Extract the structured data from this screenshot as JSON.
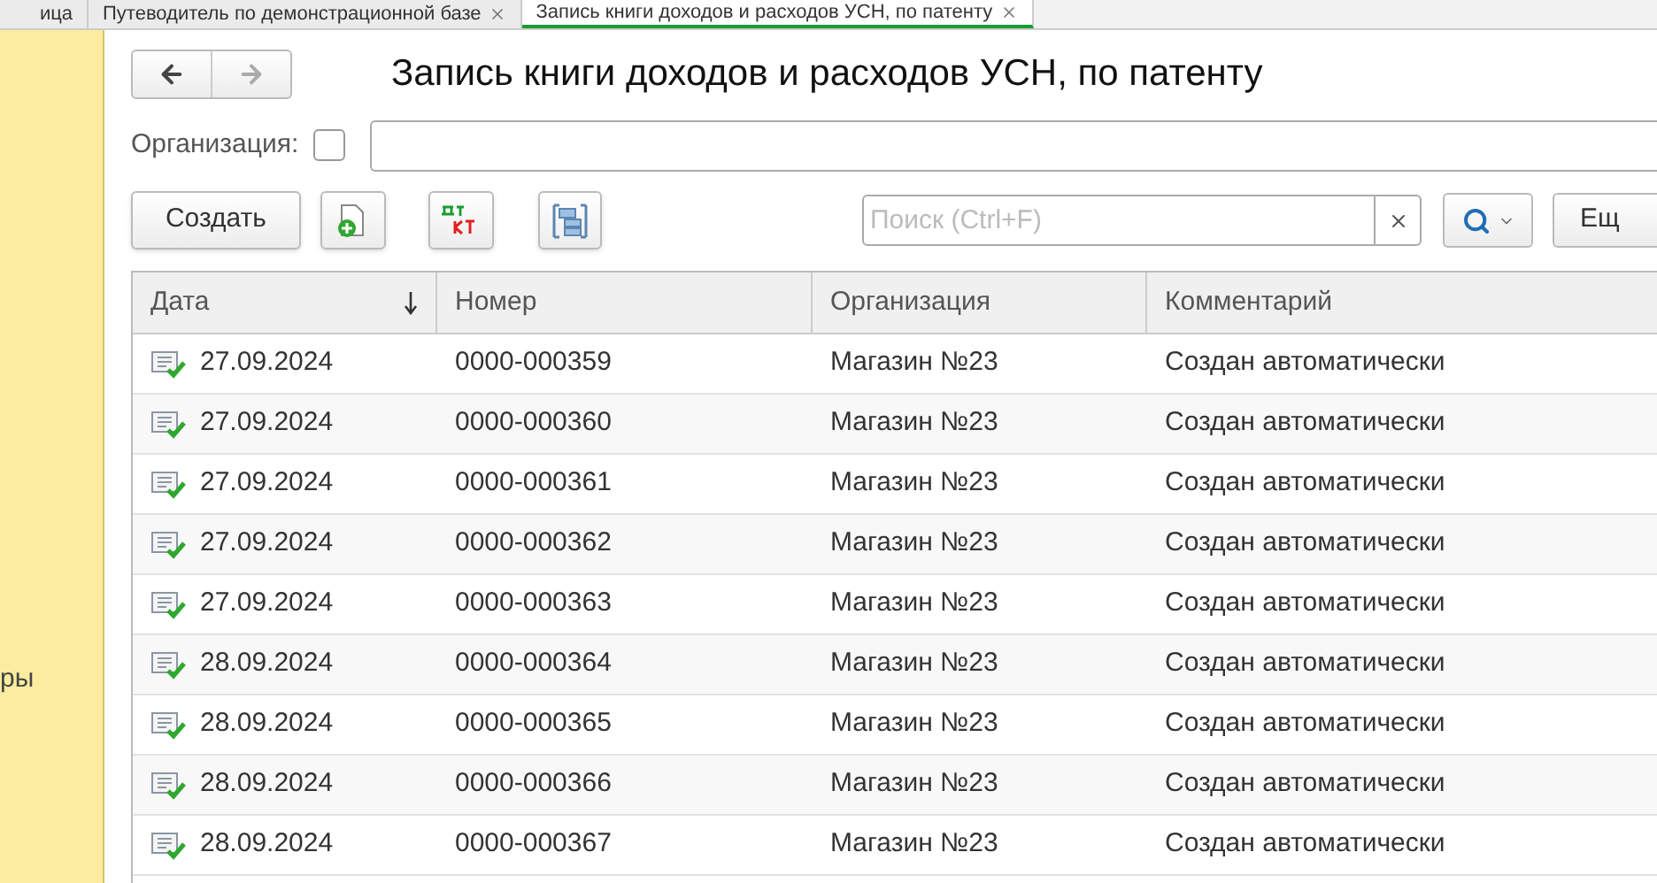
{
  "tabs": [
    {
      "label": "ица",
      "selected": false,
      "closable": false
    },
    {
      "label": "Путеводитель по демонстрационной базе",
      "selected": false,
      "closable": true
    },
    {
      "label": "Запись книги доходов и расходов УСН, по патенту",
      "selected": true,
      "closable": true
    }
  ],
  "sidebar": {
    "items": [
      "ры"
    ]
  },
  "form": {
    "title": "Запись книги доходов и расходов УСН, по патенту",
    "organization": {
      "label": "Организация:",
      "checked": false
    },
    "toolbar": {
      "create": "Создать",
      "search_placeholder": "Поиск (Ctrl+F)",
      "more": "Ещ"
    }
  },
  "table": {
    "columns": [
      {
        "label": "Дата",
        "sorted": true
      },
      {
        "label": "Номер",
        "sorted": false
      },
      {
        "label": "Организация",
        "sorted": false
      },
      {
        "label": "Комментарий",
        "sorted": false
      }
    ],
    "rows": [
      {
        "date": "27.09.2024",
        "number": "0000-000359",
        "organization": "Магазин №23",
        "comment": "Создан автоматически"
      },
      {
        "date": "27.09.2024",
        "number": "0000-000360",
        "organization": "Магазин №23",
        "comment": "Создан автоматически"
      },
      {
        "date": "27.09.2024",
        "number": "0000-000361",
        "organization": "Магазин №23",
        "comment": "Создан автоматически"
      },
      {
        "date": "27.09.2024",
        "number": "0000-000362",
        "organization": "Магазин №23",
        "comment": "Создан автоматически"
      },
      {
        "date": "27.09.2024",
        "number": "0000-000363",
        "organization": "Магазин №23",
        "comment": "Создан автоматически"
      },
      {
        "date": "28.09.2024",
        "number": "0000-000364",
        "organization": "Магазин №23",
        "comment": "Создан автоматически"
      },
      {
        "date": "28.09.2024",
        "number": "0000-000365",
        "organization": "Магазин №23",
        "comment": "Создан автоматически"
      },
      {
        "date": "28.09.2024",
        "number": "0000-000366",
        "organization": "Магазин №23",
        "comment": "Создан автоматически"
      },
      {
        "date": "28.09.2024",
        "number": "0000-000367",
        "organization": "Магазин №23",
        "comment": "Создан автоматически"
      }
    ]
  }
}
